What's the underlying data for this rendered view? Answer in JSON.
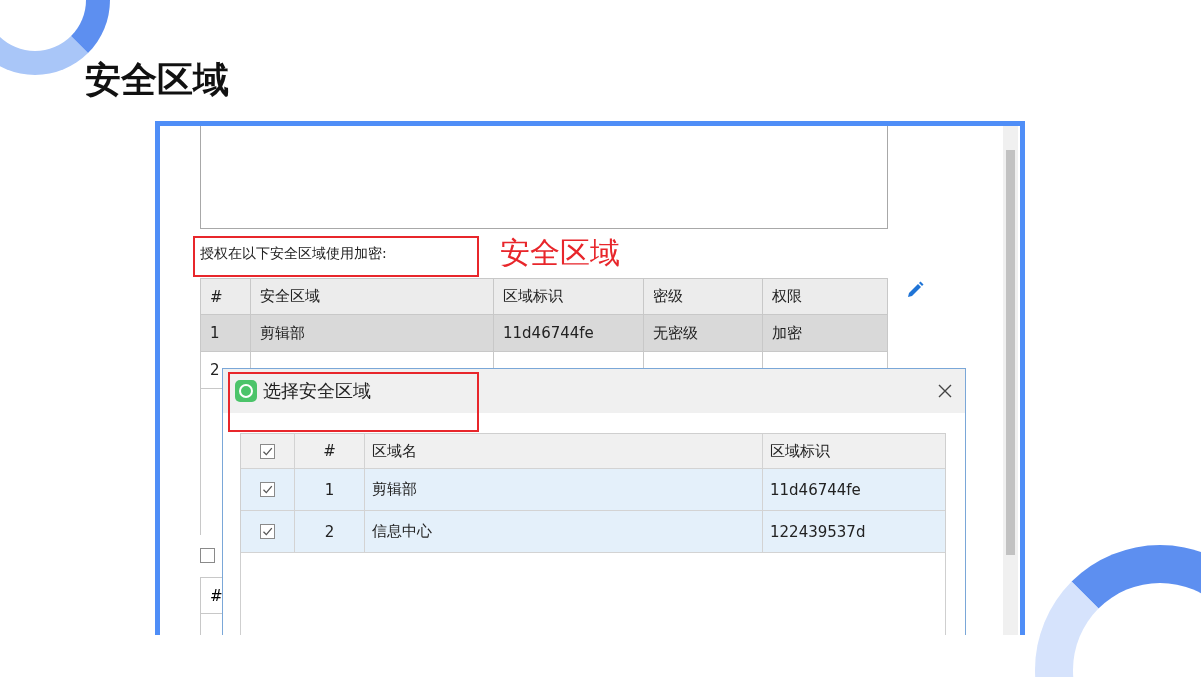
{
  "slide": {
    "title": "安全区域"
  },
  "app": {
    "label": "授权在以下安全区域使用加密:",
    "annotation": "安全区域",
    "zones_table": {
      "columns": [
        "#",
        "安全区域",
        "区域标识",
        "密级",
        "权限"
      ],
      "rows": [
        {
          "cells": [
            "1",
            "剪辑部",
            "11d46744fe",
            "无密级",
            "加密"
          ],
          "selected": true
        },
        {
          "cells": [
            "2"
          ],
          "selected": false
        }
      ]
    },
    "lower_checkbox": {
      "checked": false
    },
    "lower_table": {
      "columns": [
        "#"
      ]
    }
  },
  "dialog": {
    "title": "选择安全区域",
    "header_checked": true,
    "columns": [
      "#",
      "区域名",
      "区域标识"
    ],
    "rows": [
      {
        "cells": [
          "1",
          "剪辑部",
          "11d46744fe"
        ],
        "checked": true,
        "selected": true
      },
      {
        "cells": [
          "2",
          "信息中心",
          "122439537d"
        ],
        "checked": true,
        "selected": true
      }
    ]
  }
}
